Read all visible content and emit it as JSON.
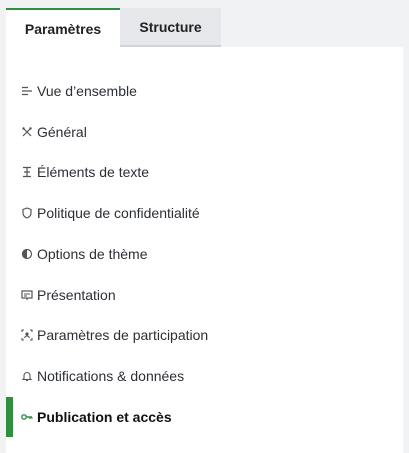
{
  "tabs": [
    {
      "label": "Paramètres",
      "active": true
    },
    {
      "label": "Structure",
      "active": false
    }
  ],
  "menu": {
    "items": [
      {
        "label": "Vue d’ensemble",
        "icon": "list-icon"
      },
      {
        "label": "Général",
        "icon": "tools-icon"
      },
      {
        "label": "Éléments de texte",
        "icon": "text-cursor-icon"
      },
      {
        "label": "Politique de confidentialité",
        "icon": "shield-icon"
      },
      {
        "label": "Options de thème",
        "icon": "contrast-icon"
      },
      {
        "label": "Présentation",
        "icon": "presentation-icon"
      },
      {
        "label": "Paramètres de participation",
        "icon": "participants-icon"
      },
      {
        "label": "Notifications & données",
        "icon": "bell-icon"
      },
      {
        "label": "Publication et accès",
        "icon": "key-icon",
        "active": true
      }
    ]
  },
  "colors": {
    "accent": "#2f8f3f",
    "background": "#f1f2f4",
    "panel": "#ffffff",
    "inactive_tab": "#e5e7eb"
  }
}
